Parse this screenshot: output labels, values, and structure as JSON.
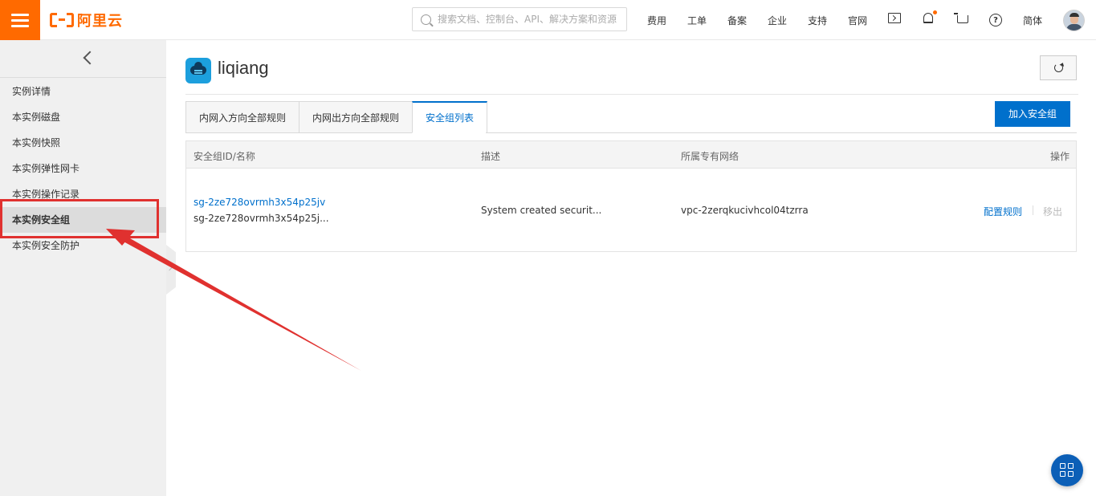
{
  "header": {
    "logo_text": "阿里云",
    "search_placeholder": "搜索文档、控制台、API、解决方案和资源",
    "nav": [
      "费用",
      "工单",
      "备案",
      "企业",
      "支持",
      "官网"
    ],
    "language": "简体",
    "icons": [
      "menu-icon",
      "search-icon",
      "terminal-icon",
      "bell-icon",
      "cart-icon",
      "help-icon"
    ],
    "accent_color": "#ff6a00"
  },
  "sidebar": {
    "items": [
      {
        "label": "实例详情"
      },
      {
        "label": "本实例磁盘"
      },
      {
        "label": "本实例快照"
      },
      {
        "label": "本实例弹性网卡"
      },
      {
        "label": "本实例操作记录"
      },
      {
        "label": "本实例安全组",
        "active": true
      },
      {
        "label": "本实例安全防护"
      }
    ]
  },
  "main": {
    "title": "liqiang",
    "tabs": [
      {
        "label": "内网入方向全部规则"
      },
      {
        "label": "内网出方向全部规则"
      },
      {
        "label": "安全组列表",
        "active": true
      }
    ],
    "add_button": "加入安全组",
    "table": {
      "headers": [
        "安全组ID/名称",
        "描述",
        "所属专有网络",
        "操作"
      ],
      "rows": [
        {
          "id": "sg-2ze728ovrmh3x54p25jv",
          "name": "sg-2ze728ovrmh3x54p25j...",
          "description": "System created securit...",
          "vpc": "vpc-2zerqkucivhcol04tzrra",
          "action_configure": "配置规则",
          "action_remove": "移出"
        }
      ]
    }
  },
  "colors": {
    "primary": "#0070cc",
    "annotation_red": "#e0312f"
  }
}
